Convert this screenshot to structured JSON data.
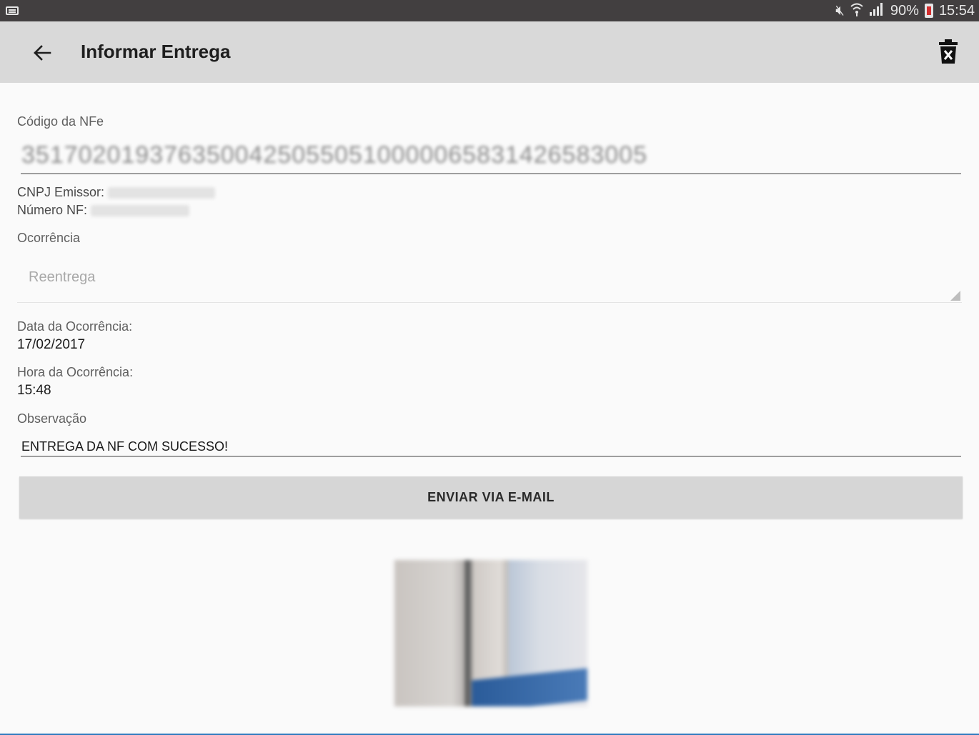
{
  "status_bar": {
    "icons": [
      "keyboard-icon",
      "mute-icon",
      "wifi-icon",
      "signal-icon",
      "battery-icon"
    ],
    "battery": "90%",
    "time": "15:54"
  },
  "app_bar": {
    "back_icon": "arrow-left-icon",
    "title": "Informar Entrega",
    "delete_icon": "trash-x-icon"
  },
  "form": {
    "nfe_label": "Código da NFe",
    "nfe_value": "35170201937635004250550510000065831426583005",
    "cnpj_label": "CNPJ Emissor:",
    "numero_label": "Número NF:",
    "ocorrencia_label": "Ocorrência",
    "ocorrencia_value": "Reentrega",
    "data_label": "Data da Ocorrência:",
    "data_value": "17/02/2017",
    "hora_label": "Hora da Ocorrência:",
    "hora_value": "15:48",
    "obs_label": "Observação",
    "obs_value": "ENTREGA DA NF COM SUCESSO!",
    "email_button": "ENVIAR VIA E-MAIL"
  },
  "colors": {
    "status_bar": "#423f40",
    "app_bar": "#d9d9d9",
    "background": "#fafafa",
    "button": "#d6d6d6",
    "accent_line": "#2f7bbf"
  }
}
